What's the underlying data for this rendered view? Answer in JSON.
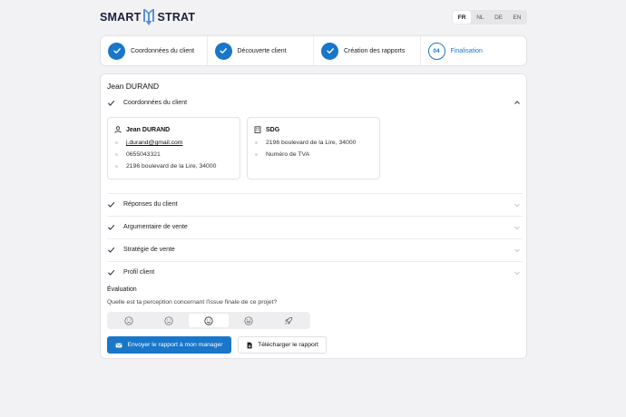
{
  "brand": {
    "name_left": "SMART",
    "name_right": "STRAT"
  },
  "languages": [
    {
      "code": "FR",
      "active": true
    },
    {
      "code": "NL",
      "active": false
    },
    {
      "code": "DE",
      "active": false
    },
    {
      "code": "EN",
      "active": false
    }
  ],
  "stepper": {
    "steps": [
      {
        "label": "Coordonnées du client",
        "status": "done"
      },
      {
        "label": "Découverte client",
        "status": "done"
      },
      {
        "label": "Création des rapports",
        "status": "done"
      },
      {
        "number": "04",
        "label": "Finalisation",
        "status": "current"
      }
    ]
  },
  "main": {
    "client_name": "Jean DURAND",
    "sections": [
      {
        "title": "Coordonnées du client",
        "expanded": true
      },
      {
        "title": "Réponses du client",
        "expanded": false
      },
      {
        "title": "Argumentaire de vente",
        "expanded": false
      },
      {
        "title": "Stratégie de vente",
        "expanded": false
      },
      {
        "title": "Profil client",
        "expanded": false
      }
    ],
    "contact_card": {
      "name": "Jean DURAND",
      "email": "j.durand@gmail.com",
      "phone": "0655043321",
      "address": "2196 boulevard de la Lire, 34000"
    },
    "company_card": {
      "name": "SDG",
      "address": "2196 boulevard de la Lire, 34000",
      "vat": "Numéro de TVA"
    },
    "evaluation": {
      "title": "Évaluation",
      "question": "Quelle est ta perception concernant l'issue finale de ce projet?",
      "options": [
        "very-sad",
        "neutral",
        "happy",
        "very-happy",
        "rocket"
      ],
      "selected_index": 2
    },
    "actions": {
      "send_label": "Envoyer le rapport à mon manager",
      "download_label": "Télécharger le rapport"
    }
  },
  "colors": {
    "accent": "#1976c9",
    "background": "#f2f2f4",
    "check": "#1b1f3b"
  }
}
